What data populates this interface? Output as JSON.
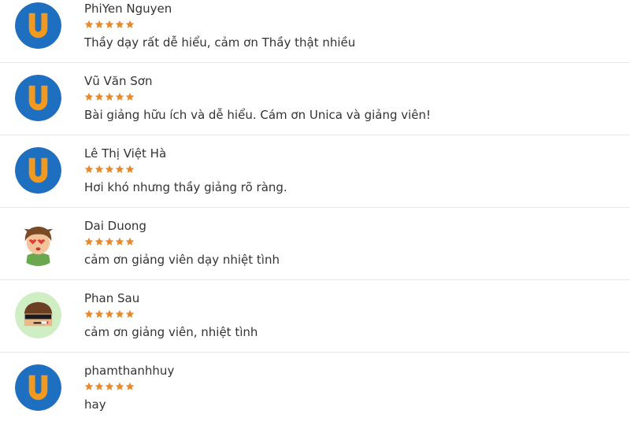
{
  "colors": {
    "star": "#e8892b",
    "unica_blue": "#1e6fc0",
    "unica_orange": "#f39a1e",
    "divider": "#e8e8e8"
  },
  "reviews": [
    {
      "name": "PhiYen Nguyen",
      "avatar": "unica-logo-icon",
      "rating": 5,
      "comment": "Thầy dạy rất dễ hiểu, cảm ơn Thầy thật nhiều"
    },
    {
      "name": "Vũ Văn Sơn",
      "avatar": "unica-logo-icon",
      "rating": 5,
      "comment": "Bài giảng hữu ích và dễ hiểu. Cám ơn Unica và giảng viên!"
    },
    {
      "name": "Lê Thị Việt Hà",
      "avatar": "unica-logo-icon",
      "rating": 5,
      "comment": "Hơi khó nhưng thầy giảng rõ ràng."
    },
    {
      "name": "Dai Duong",
      "avatar": "cartoon-boy-avatar-icon",
      "rating": 5,
      "comment": "cảm ơn giảng viên dạy nhiệt tình"
    },
    {
      "name": "Phan Sau",
      "avatar": "sunglasses-face-avatar-icon",
      "rating": 5,
      "comment": "cảm ơn giảng viên, nhiệt tình"
    },
    {
      "name": "phamthanhhuy",
      "avatar": "unica-logo-icon",
      "rating": 5,
      "comment": "hay"
    }
  ]
}
